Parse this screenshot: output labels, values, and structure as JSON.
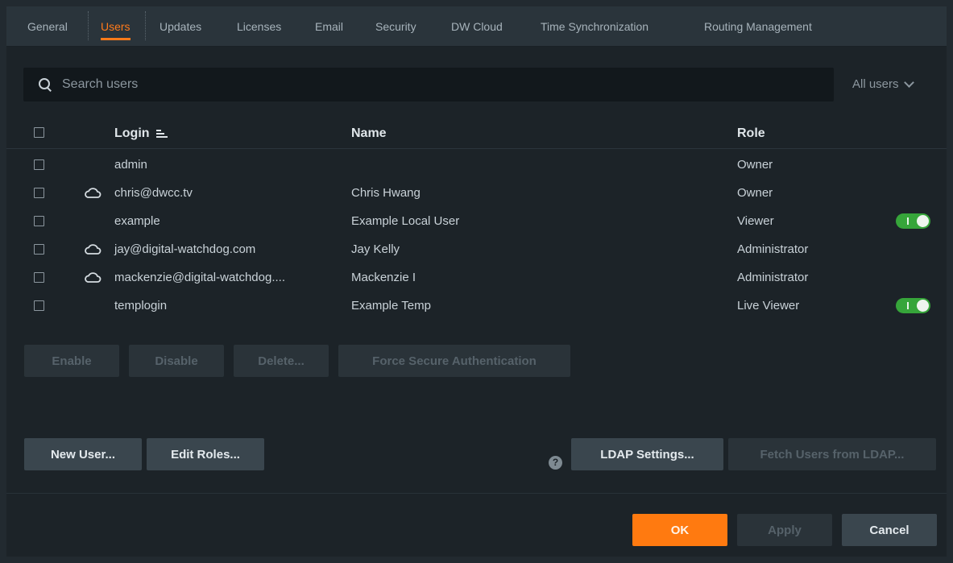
{
  "tabs": [
    {
      "label": "General"
    },
    {
      "label": "Users"
    },
    {
      "label": "Updates"
    },
    {
      "label": "Licenses"
    },
    {
      "label": "Email"
    },
    {
      "label": "Security"
    },
    {
      "label": "DW Cloud"
    },
    {
      "label": "Time Synchronization"
    },
    {
      "label": "Routing Management"
    }
  ],
  "active_tab": "Users",
  "search": {
    "placeholder": "Search users",
    "value": ""
  },
  "filter": {
    "selected": "All users"
  },
  "table": {
    "headers": {
      "login": "Login",
      "name": "Name",
      "role": "Role"
    },
    "rows": [
      {
        "login": "admin",
        "name": "",
        "role": "Owner",
        "cloud": false,
        "toggle": null
      },
      {
        "login": "chris@dwcc.tv",
        "name": "Chris Hwang",
        "role": "Owner",
        "cloud": true,
        "toggle": null
      },
      {
        "login": "example",
        "name": "Example Local User",
        "role": "Viewer",
        "cloud": false,
        "toggle": true
      },
      {
        "login": "jay@digital-watchdog.com",
        "name": "Jay Kelly",
        "role": "Administrator",
        "cloud": true,
        "toggle": null
      },
      {
        "login": "mackenzie@digital-watchdog....",
        "name": "Mackenzie I",
        "role": "Administrator",
        "cloud": true,
        "toggle": null
      },
      {
        "login": "templogin",
        "name": "Example Temp",
        "role": "Live Viewer",
        "cloud": false,
        "toggle": true
      }
    ]
  },
  "bulk_actions": {
    "enable": "Enable",
    "disable": "Disable",
    "delete": "Delete...",
    "force_secure": "Force Secure Authentication"
  },
  "actions": {
    "new_user": "New User...",
    "edit_roles": "Edit Roles...",
    "help": "?",
    "ldap_settings": "LDAP Settings...",
    "fetch_ldap": "Fetch Users from LDAP..."
  },
  "footer": {
    "ok": "OK",
    "apply": "Apply",
    "cancel": "Cancel"
  },
  "colors": {
    "accent": "#ff7a10",
    "toggle_on": "#36a53a",
    "background": "#1c2328",
    "tabbar": "#2a343b"
  }
}
